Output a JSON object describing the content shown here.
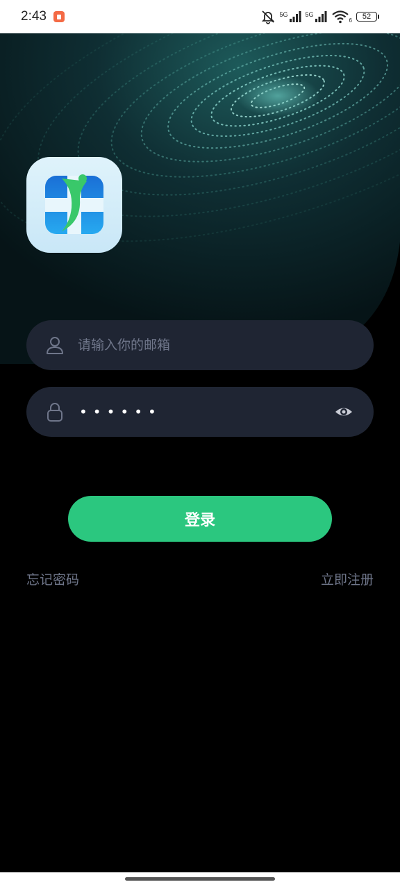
{
  "status_bar": {
    "time": "2:43",
    "network_1": "5G",
    "network_2": "5G",
    "wifi_badge": "6",
    "battery": "52"
  },
  "login": {
    "email_placeholder": "请输入你的邮箱",
    "password_masked": "••••••",
    "login_label": "登录",
    "forgot_label": "忘记密码",
    "register_label": "立即注册"
  },
  "icons": {
    "app_logo": "medical-app-logo-icon",
    "user": "user-icon",
    "lock": "lock-icon",
    "eye": "eye-icon"
  },
  "colors": {
    "accent": "#2bc77f",
    "field_bg": "#1f2533",
    "placeholder": "#6f768a",
    "background": "#000000"
  }
}
